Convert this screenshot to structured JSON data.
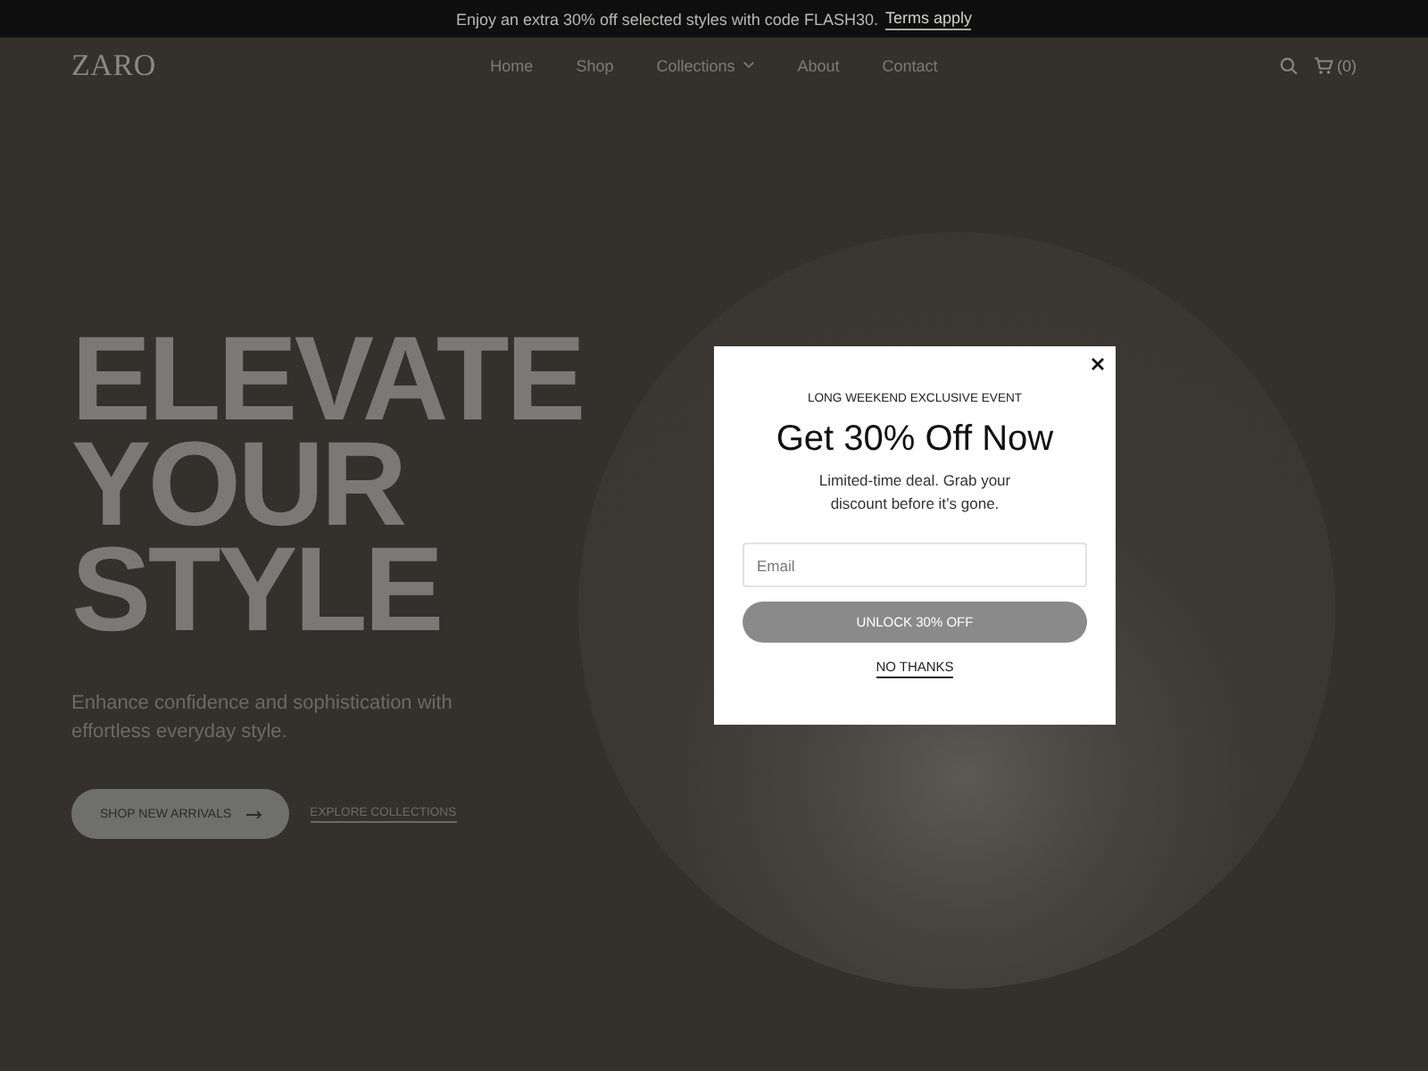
{
  "announcement": {
    "text": "Enjoy an extra 30% off selected styles with code FLASH30.",
    "link": "Terms apply"
  },
  "nav": {
    "logo": "ZARO",
    "links": [
      {
        "label": "Home",
        "dropdown": false
      },
      {
        "label": "Shop",
        "dropdown": false
      },
      {
        "label": "Collections",
        "dropdown": true
      },
      {
        "label": "About",
        "dropdown": false
      },
      {
        "label": "Contact",
        "dropdown": false
      }
    ],
    "cart_count": "(0)"
  },
  "hero": {
    "heading": "ELEVATE YOUR STYLE",
    "subtitle": "Enhance confidence and sophistication with effortless everyday style.",
    "primary_button": "SHOP NEW ARRIVALS",
    "secondary_link": "EXPLORE COLLECTIONS"
  },
  "popup": {
    "eyebrow": "LONG WEEKEND EXCLUSIVE EVENT",
    "title": "Get 30% Off Now",
    "text": "Limited-time deal. Grab your discount before it’s gone.",
    "email": {
      "placeholder": "Email"
    },
    "submit": "UNLOCK 30% OFF",
    "dismiss": "NO THANKS"
  }
}
